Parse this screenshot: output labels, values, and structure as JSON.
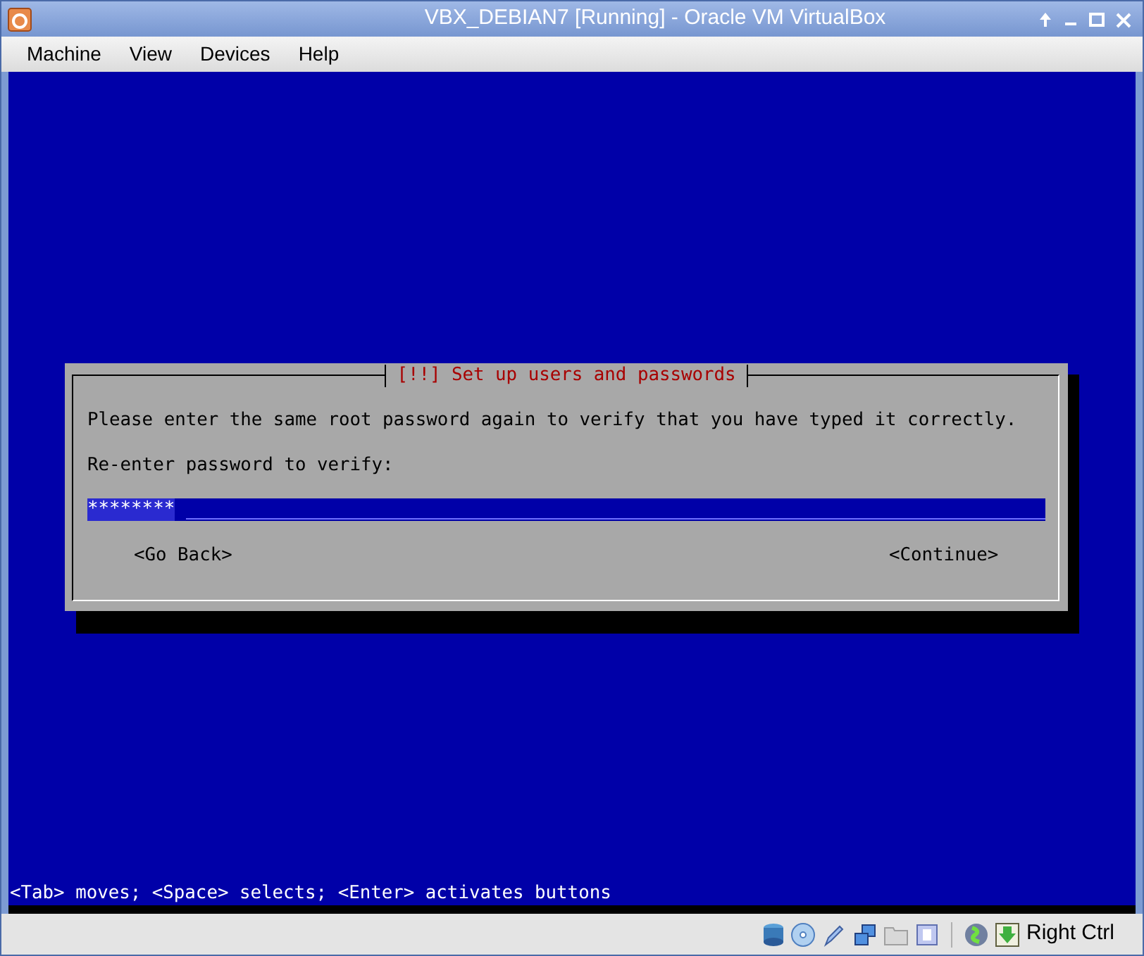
{
  "window": {
    "title": "VBX_DEBIAN7 [Running] - Oracle VM VirtualBox"
  },
  "menu": [
    "Machine",
    "View",
    "Devices",
    "Help"
  ],
  "dialog": {
    "title": "[!!] Set up users and passwords",
    "message": "Please enter the same root password again to verify that you have typed it correctly.",
    "prompt": "Re-enter password to verify:",
    "field": {
      "value": "********"
    },
    "buttons": [
      "<Go Back>",
      "<Continue>"
    ]
  },
  "help_line": "<Tab> moves; <Space> selects; <Enter> activates buttons",
  "status_bar": {
    "host_key": "Right Ctrl"
  }
}
